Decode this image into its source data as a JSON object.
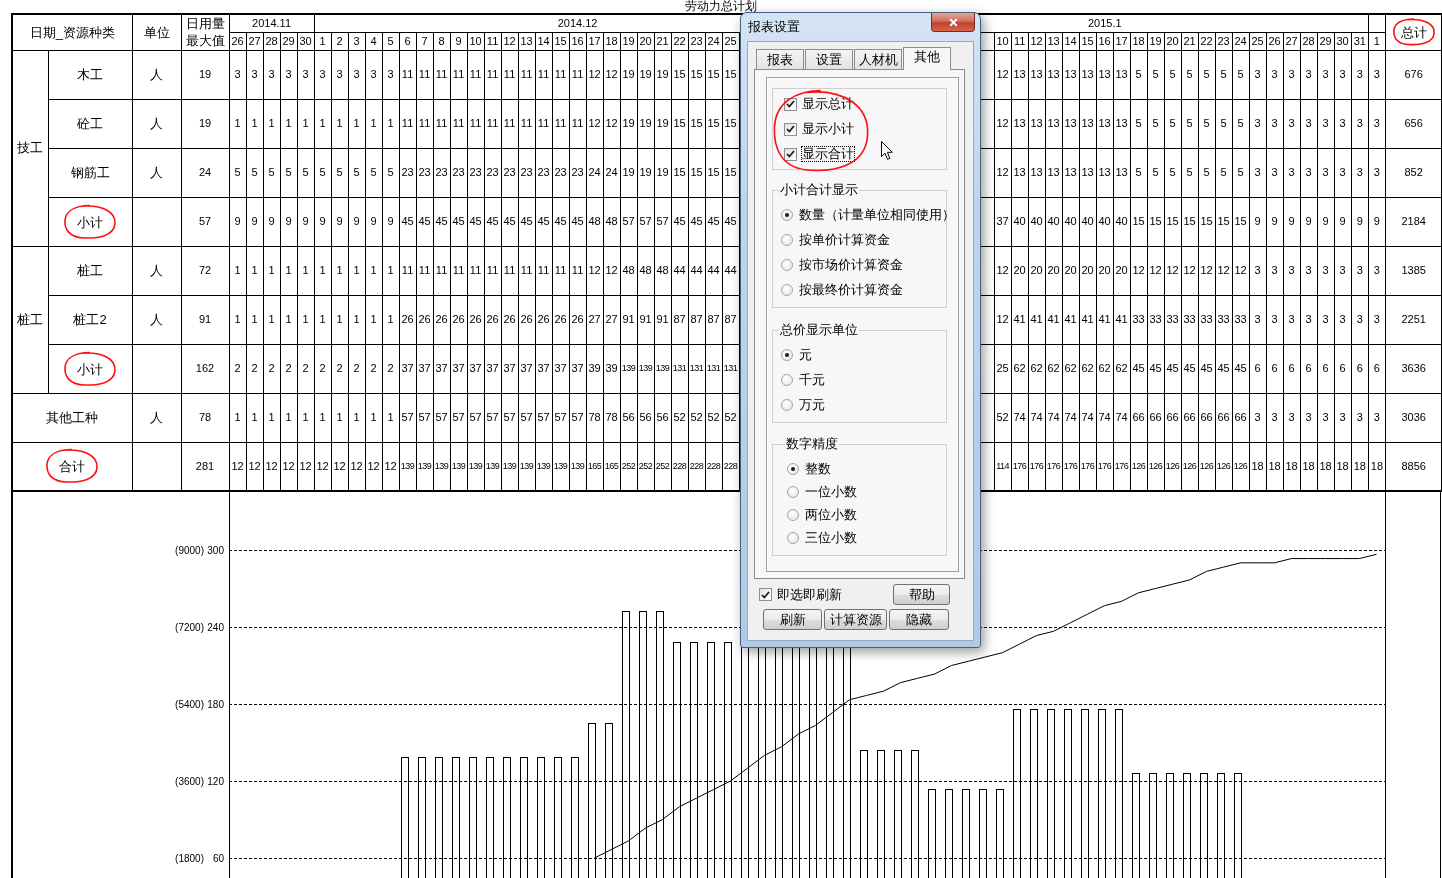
{
  "title": "劳动力总计划",
  "table": {
    "header": {
      "category": "日期_资源种类",
      "unit": "单位",
      "max_daily": [
        "日用量",
        "最大值"
      ],
      "total": {
        "label": "总计",
        "circled": true
      }
    },
    "months": [
      {
        "label": "2014.11",
        "days": [
          "26",
          "27",
          "28",
          "29",
          "30"
        ]
      },
      {
        "label": "2014.12",
        "days": [
          "1",
          "2",
          "3",
          "4",
          "5",
          "6",
          "7",
          "8",
          "9",
          "10",
          "11",
          "12",
          "13",
          "14",
          "15",
          "16",
          "17",
          "18",
          "19",
          "20",
          "21",
          "22",
          "23",
          "24",
          "25"
        ]
      },
      {
        "label": "2015.1",
        "days": [
          "10",
          "11",
          "12",
          "13",
          "14",
          "15",
          "16",
          "17",
          "18",
          "19",
          "20",
          "21",
          "22",
          "23",
          "24",
          "25",
          "26",
          "27",
          "28",
          "29",
          "30",
          "31"
        ]
      },
      {
        "days": [
          "1"
        ]
      }
    ],
    "rows": [
      {
        "kind": "group",
        "label": "技工",
        "children": [
          {
            "label": "木工",
            "circled": false,
            "unit": "人",
            "max": "19",
            "values": [
              "3",
              "3",
              "3",
              "3",
              "3",
              "3",
              "3",
              "3",
              "3",
              "3",
              "11",
              "11",
              "11",
              "11",
              "11",
              "11",
              "11",
              "11",
              "11",
              "11",
              "11",
              "12",
              "12",
              "19",
              "19",
              "19",
              "15",
              "15",
              "15",
              "15",
              "12",
              "13",
              "13",
              "13",
              "13",
              "13",
              "13",
              "13",
              "5",
              "5",
              "5",
              "5",
              "5",
              "5",
              "5",
              "3",
              "3",
              "3",
              "3",
              "3",
              "3",
              "3",
              "3"
            ],
            "total": "676"
          },
          {
            "label": "砼工",
            "circled": false,
            "unit": "人",
            "max": "19",
            "values": [
              "1",
              "1",
              "1",
              "1",
              "1",
              "1",
              "1",
              "1",
              "1",
              "1",
              "11",
              "11",
              "11",
              "11",
              "11",
              "11",
              "11",
              "11",
              "11",
              "11",
              "11",
              "12",
              "12",
              "19",
              "19",
              "19",
              "15",
              "15",
              "15",
              "15",
              "12",
              "13",
              "13",
              "13",
              "13",
              "13",
              "13",
              "13",
              "5",
              "5",
              "5",
              "5",
              "5",
              "5",
              "5",
              "3",
              "3",
              "3",
              "3",
              "3",
              "3",
              "3",
              "3"
            ],
            "total": "656"
          },
          {
            "label": "钢筋工",
            "circled": false,
            "unit": "人",
            "max": "24",
            "values": [
              "5",
              "5",
              "5",
              "5",
              "5",
              "5",
              "5",
              "5",
              "5",
              "5",
              "23",
              "23",
              "23",
              "23",
              "23",
              "23",
              "23",
              "23",
              "23",
              "23",
              "23",
              "24",
              "24",
              "19",
              "19",
              "19",
              "15",
              "15",
              "15",
              "15",
              "12",
              "13",
              "13",
              "13",
              "13",
              "13",
              "13",
              "13",
              "5",
              "5",
              "5",
              "5",
              "5",
              "5",
              "5",
              "3",
              "3",
              "3",
              "3",
              "3",
              "3",
              "3",
              "3"
            ],
            "total": "852"
          },
          {
            "label": "小计",
            "circled": true,
            "max": "57",
            "values": [
              "9",
              "9",
              "9",
              "9",
              "9",
              "9",
              "9",
              "9",
              "9",
              "9",
              "45",
              "45",
              "45",
              "45",
              "45",
              "45",
              "45",
              "45",
              "45",
              "45",
              "45",
              "48",
              "48",
              "57",
              "57",
              "57",
              "45",
              "45",
              "45",
              "45",
              "37",
              "40",
              "40",
              "40",
              "40",
              "40",
              "40",
              "40",
              "15",
              "15",
              "15",
              "15",
              "15",
              "15",
              "15",
              "9",
              "9",
              "9",
              "9",
              "9",
              "9",
              "9",
              "9"
            ],
            "total": "2184"
          }
        ]
      },
      {
        "kind": "group",
        "label": "桩工",
        "children": [
          {
            "label": "桩工",
            "circled": false,
            "unit": "人",
            "max": "72",
            "values": [
              "1",
              "1",
              "1",
              "1",
              "1",
              "1",
              "1",
              "1",
              "1",
              "1",
              "11",
              "11",
              "11",
              "11",
              "11",
              "11",
              "11",
              "11",
              "11",
              "11",
              "11",
              "12",
              "12",
              "48",
              "48",
              "48",
              "44",
              "44",
              "44",
              "44",
              "12",
              "20",
              "20",
              "20",
              "20",
              "20",
              "20",
              "20",
              "12",
              "12",
              "12",
              "12",
              "12",
              "12",
              "12",
              "3",
              "3",
              "3",
              "3",
              "3",
              "3",
              "3",
              "3"
            ],
            "total": "1385"
          },
          {
            "label": "桩工2",
            "circled": false,
            "unit": "人",
            "max": "91",
            "values": [
              "1",
              "1",
              "1",
              "1",
              "1",
              "1",
              "1",
              "1",
              "1",
              "1",
              "26",
              "26",
              "26",
              "26",
              "26",
              "26",
              "26",
              "26",
              "26",
              "26",
              "26",
              "27",
              "27",
              "91",
              "91",
              "91",
              "87",
              "87",
              "87",
              "87",
              "12",
              "41",
              "41",
              "41",
              "41",
              "41",
              "41",
              "41",
              "33",
              "33",
              "33",
              "33",
              "33",
              "33",
              "33",
              "3",
              "3",
              "3",
              "3",
              "3",
              "3",
              "3",
              "3"
            ],
            "total": "2251"
          },
          {
            "label": "小计",
            "circled": true,
            "max": "162",
            "values": [
              "2",
              "2",
              "2",
              "2",
              "2",
              "2",
              "2",
              "2",
              "2",
              "2",
              "37",
              "37",
              "37",
              "37",
              "37",
              "37",
              "37",
              "37",
              "37",
              "37",
              "37",
              "39",
              "39",
              "139",
              "139",
              "139",
              "131",
              "131",
              "131",
              "131",
              "25",
              "62",
              "62",
              "62",
              "62",
              "62",
              "62",
              "62",
              "45",
              "45",
              "45",
              "45",
              "45",
              "45",
              "45",
              "6",
              "6",
              "6",
              "6",
              "6",
              "6",
              "6",
              "6"
            ],
            "total": "3636"
          }
        ]
      },
      {
        "kind": "item",
        "label": "其他工种",
        "circled": false,
        "unit": "人",
        "max": "78",
        "values": [
          "1",
          "1",
          "1",
          "1",
          "1",
          "1",
          "1",
          "1",
          "1",
          "1",
          "57",
          "57",
          "57",
          "57",
          "57",
          "57",
          "57",
          "57",
          "57",
          "57",
          "57",
          "78",
          "78",
          "56",
          "56",
          "56",
          "52",
          "52",
          "52",
          "52",
          "52",
          "74",
          "74",
          "74",
          "74",
          "74",
          "74",
          "74",
          "66",
          "66",
          "66",
          "66",
          "66",
          "66",
          "66",
          "3",
          "3",
          "3",
          "3",
          "3",
          "3",
          "3",
          "3"
        ],
        "total": "3036"
      },
      {
        "kind": "item",
        "label": "合计",
        "circled": true,
        "max": "281",
        "values": [
          "12",
          "12",
          "12",
          "12",
          "12",
          "12",
          "12",
          "12",
          "12",
          "12",
          "139",
          "139",
          "139",
          "139",
          "139",
          "139",
          "139",
          "139",
          "139",
          "139",
          "139",
          "165",
          "165",
          "252",
          "252",
          "252",
          "228",
          "228",
          "228",
          "228",
          "114",
          "176",
          "176",
          "176",
          "176",
          "176",
          "176",
          "176",
          "126",
          "126",
          "126",
          "126",
          "126",
          "126",
          "126",
          "18",
          "18",
          "18",
          "18",
          "18",
          "18",
          "18",
          "18"
        ],
        "total": "8856"
      }
    ]
  },
  "chart_panel": {
    "bar_chart": {
      "chart_data": {
        "type": "bar",
        "grid": true,
        "ylim": [
          60,
          345
        ],
        "yticks": [
          {
            "value": 60,
            "label": "60"
          },
          {
            "value": 120,
            "label": "120"
          },
          {
            "value": 180,
            "label": "180"
          },
          {
            "value": 240,
            "label": "240"
          },
          {
            "value": 300,
            "label": "300"
          }
        ],
        "categories": [
          null,
          null,
          null,
          null,
          null,
          null,
          null,
          null,
          null,
          null,
          null,
          null,
          null,
          null,
          null,
          null,
          null,
          null,
          null,
          null,
          null,
          null,
          null,
          null,
          null,
          null,
          null,
          null,
          null,
          null,
          null,
          null,
          null,
          null,
          null,
          null,
          null,
          null,
          null,
          null,
          null,
          null,
          null,
          null,
          null,
          null,
          null,
          null,
          null,
          null,
          null,
          null,
          null,
          null,
          null,
          null,
          null,
          null,
          null,
          null,
          null,
          null,
          null,
          null,
          null,
          null,
          null,
          null
        ],
        "series": [
          {
            "color": "#ffffff",
            "values": [
              null,
              null,
              null,
              null,
              null,
              null,
              null,
              null,
              null,
              null,
              139,
              139,
              139,
              139,
              139,
              139,
              139,
              139,
              139,
              139,
              139,
              165,
              165,
              252,
              252,
              252,
              228,
              228,
              228,
              228,
              null,
              null,
              null,
              null,
              null,
              null,
              null,
              144,
              144,
              144,
              144,
              114,
              114,
              114,
              114,
              114,
              176,
              176,
              176,
              176,
              176,
              176,
              176,
              126,
              126,
              126,
              126,
              126,
              126,
              126,
              null,
              null,
              null,
              null,
              null,
              null,
              null,
              null
            ]
          }
        ]
      }
    },
    "line_chart": {
      "chart_data": {
        "type": "line",
        "grid": true,
        "ylim": [
          1800,
          10356
        ],
        "yticks": [
          {
            "value": 1800,
            "label": "(1800)"
          },
          {
            "value": 3600,
            "label": "(3600)"
          },
          {
            "value": 5400,
            "label": "(5400)"
          },
          {
            "value": 7200,
            "label": "(7200)"
          },
          {
            "value": 9000,
            "label": "(9000)"
          }
        ],
        "categories": [
          null,
          null,
          null,
          null,
          null,
          null,
          null,
          null,
          null,
          null,
          null,
          null,
          null,
          null,
          null,
          null,
          null,
          null,
          null,
          null,
          null,
          null,
          null,
          null,
          null,
          null,
          null,
          null,
          null,
          null,
          null,
          null,
          null,
          null,
          null,
          null,
          null,
          null,
          null,
          null,
          null,
          null,
          null,
          null,
          null,
          null,
          null,
          null,
          null,
          null,
          null,
          null,
          null,
          null,
          null,
          null,
          null,
          null,
          null,
          null,
          null,
          null,
          null,
          null,
          null,
          null,
          null,
          null
        ],
        "series": [
          {
            "color": "#000000",
            "values": [
              null,
              null,
              null,
              null,
              null,
              null,
              null,
              null,
              null,
              null,
              null,
              null,
              null,
              null,
              null,
              null,
              null,
              null,
              null,
              null,
              null,
              1800,
              2000,
              2200,
              2500,
              2700,
              3000,
              3200,
              3400,
              3600,
              3900,
              4200,
              4400,
              4700,
              4900,
              5200,
              5500,
              5600,
              5700,
              5900,
              6000,
              6100,
              6300,
              6400,
              6500,
              6600,
              6800,
              7000,
              7100,
              7300,
              7500,
              7700,
              7800,
              8000,
              8100,
              8200,
              8300,
              8500,
              8600,
              8700,
              8700,
              8700,
              8800,
              8800,
              8800,
              8800,
              8800,
              8900
            ]
          }
        ]
      }
    }
  },
  "dialog": {
    "title": "报表设置",
    "tabs": [
      {
        "label": "报表",
        "selected": false
      },
      {
        "label": "设置",
        "selected": false
      },
      {
        "label": "人材机",
        "selected": false
      },
      {
        "label": "其他",
        "selected": true
      }
    ],
    "checkbox_group": {
      "circled": true,
      "items": [
        {
          "label": "显示总计",
          "checked": true,
          "focused": false
        },
        {
          "label": "显示小计",
          "checked": true,
          "focused": false
        },
        {
          "label": "显示合计",
          "checked": true,
          "focused": true
        }
      ]
    },
    "radio_groups": [
      {
        "title": "小计合计显示",
        "options": [
          {
            "label": "数量（计量单位相同使用）",
            "selected": true
          },
          {
            "label": "按单价计算资金",
            "selected": false
          },
          {
            "label": "按市场价计算资金",
            "selected": false
          },
          {
            "label": "按最终价计算资金",
            "selected": false
          }
        ]
      },
      {
        "title": "总价显示单位",
        "options": [
          {
            "label": "元",
            "selected": true
          },
          {
            "label": "千元",
            "selected": false
          },
          {
            "label": "万元",
            "selected": false
          }
        ]
      },
      {
        "title": "数字精度",
        "options": [
          {
            "label": "整数",
            "selected": true
          },
          {
            "label": "一位小数",
            "selected": false
          },
          {
            "label": "两位小数",
            "selected": false
          },
          {
            "label": "三位小数",
            "selected": false
          }
        ]
      }
    ],
    "auto_refresh": {
      "label": "即选即刷新",
      "checked": true
    },
    "help_button": "帮助",
    "buttons": [
      "刷新",
      "计算资源",
      "隐藏"
    ]
  }
}
